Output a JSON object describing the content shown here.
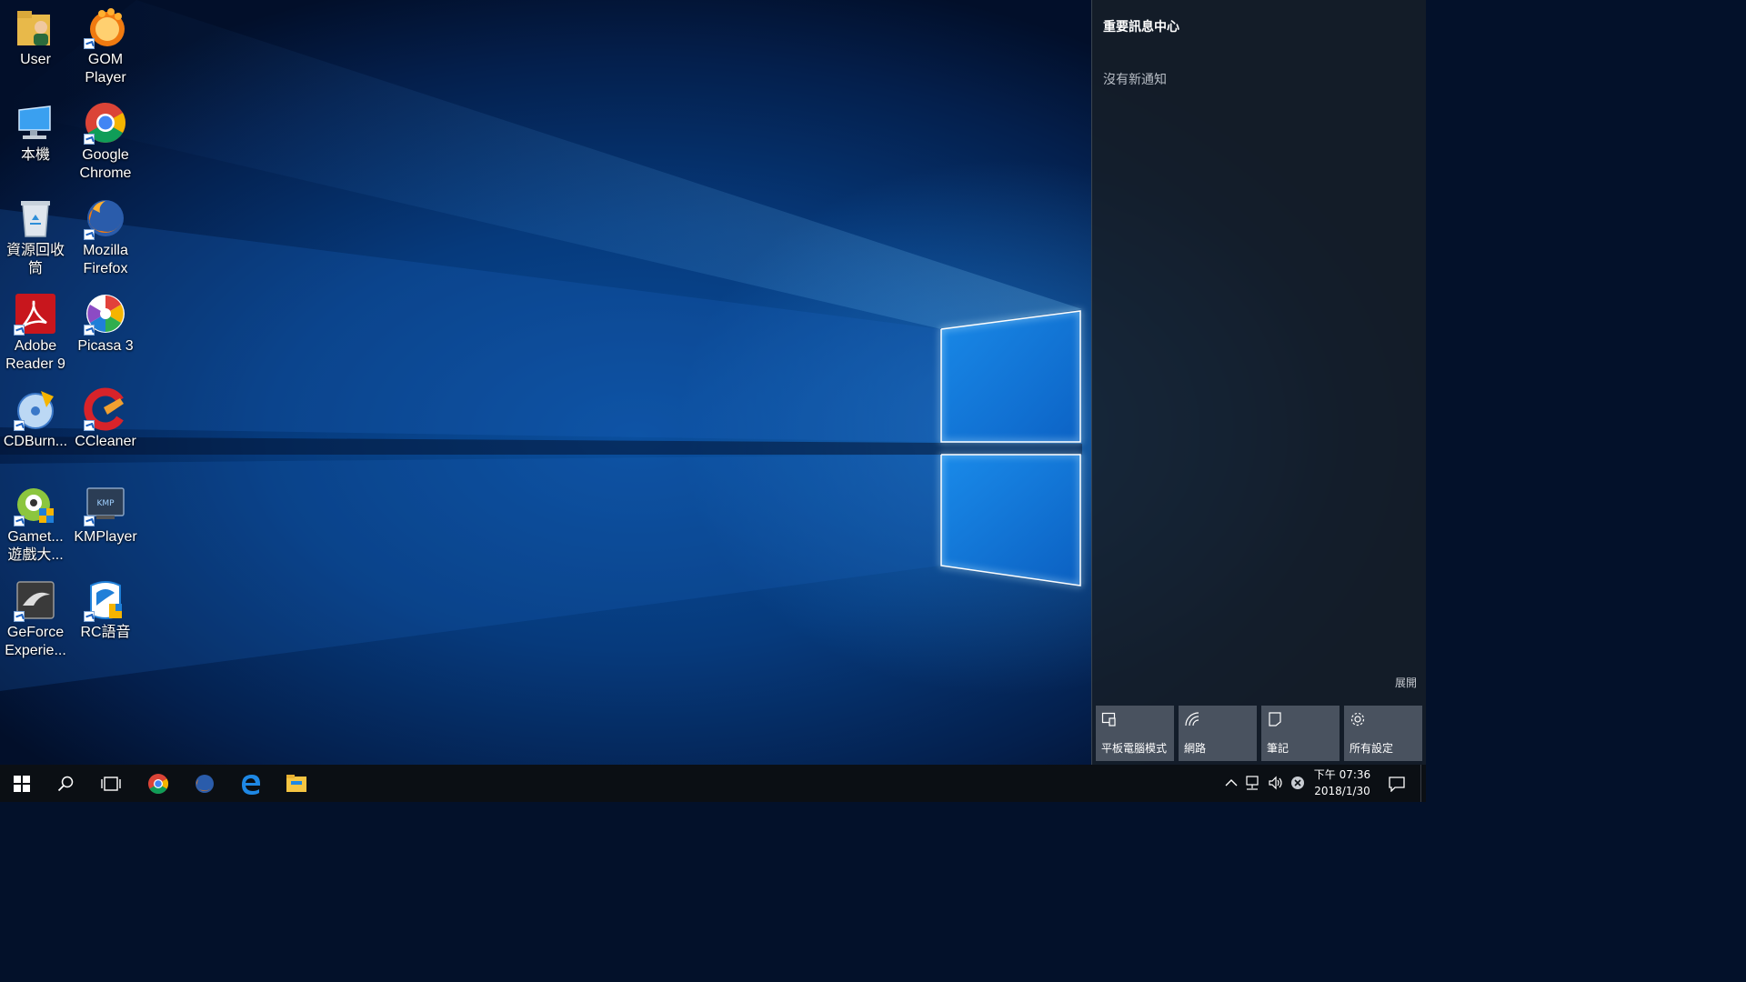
{
  "desktop": {
    "icons": [
      {
        "name": "user-folder-icon",
        "label": "User"
      },
      {
        "name": "gom-player-icon",
        "label": "GOM Player"
      },
      {
        "name": "this-pc-icon",
        "label": "本機"
      },
      {
        "name": "google-chrome-icon",
        "label": "Google Chrome"
      },
      {
        "name": "recycle-bin-icon",
        "label": "資源回收筒"
      },
      {
        "name": "mozilla-firefox-icon",
        "label": "Mozilla Firefox"
      },
      {
        "name": "adobe-reader-icon",
        "label": "Adobe Reader 9"
      },
      {
        "name": "picasa-icon",
        "label": "Picasa 3"
      },
      {
        "name": "cdburnerxp-icon",
        "label": "CDBurn..."
      },
      {
        "name": "ccleaner-icon",
        "label": "CCleaner"
      },
      {
        "name": "gametower-icon",
        "label": "Gamet... 遊戲大..."
      },
      {
        "name": "kmplayer-icon",
        "label": "KMPlayer"
      },
      {
        "name": "geforce-experience-icon",
        "label": "GeForce Experie..."
      },
      {
        "name": "rc-voice-icon",
        "label": "RC語音"
      }
    ]
  },
  "action_center": {
    "title": "重要訊息中心",
    "empty_message": "沒有新通知",
    "expand_label": "展開",
    "quick_actions": [
      {
        "label": "平板電腦模式",
        "icon": "tablet-mode-icon"
      },
      {
        "label": "網路",
        "icon": "network-icon"
      },
      {
        "label": "筆記",
        "icon": "note-icon"
      },
      {
        "label": "所有設定",
        "icon": "settings-gear-icon"
      }
    ]
  },
  "taskbar": {
    "pinned": [
      "start-icon",
      "search-icon",
      "task-view-icon",
      "chrome-icon",
      "firefox-icon",
      "edge-icon",
      "file-explorer-icon"
    ],
    "tray": [
      "chevron-up-icon",
      "network-wired-icon",
      "volume-icon",
      "error-icon"
    ],
    "clock": {
      "time": "下午 07:36",
      "date": "2018/1/30"
    },
    "notification_icon": "action-center-icon"
  },
  "colors": {
    "taskbar_bg": "#0b0f14",
    "action_center_bg": "#161e28",
    "tile_bg": "#545c68",
    "wallpaper_blue": "#0a4f9e"
  }
}
